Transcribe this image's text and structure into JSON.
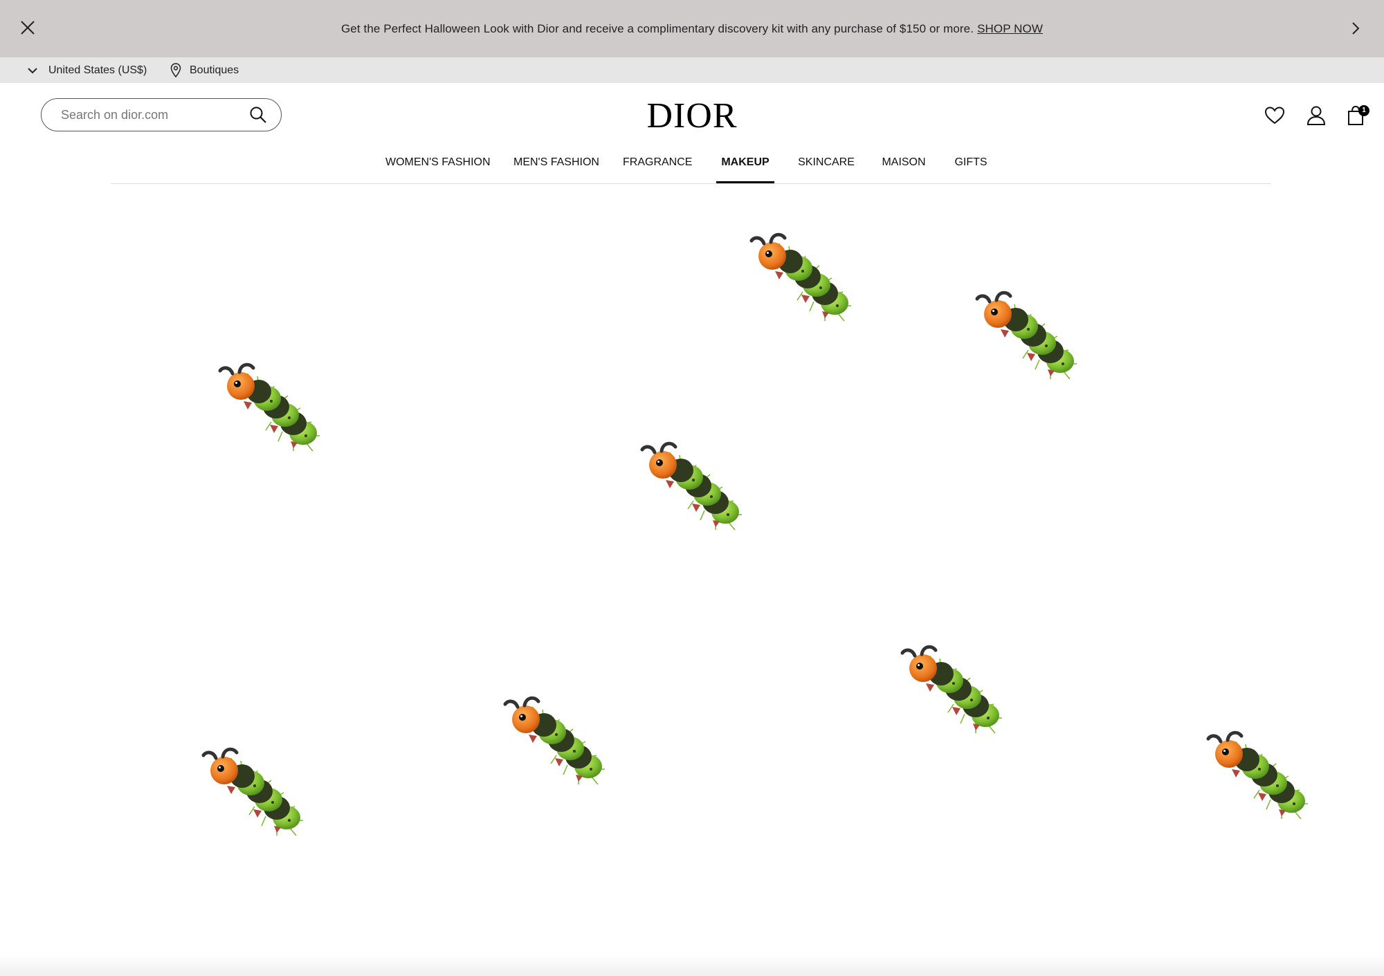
{
  "promo": {
    "text": "Get the Perfect Halloween Look with Dior and receive a complimentary discovery kit with any purchase of $150 or more.",
    "link": "SHOP NOW",
    "background": "#d0cbcb"
  },
  "utility": {
    "country": "United States (US$)",
    "boutiques": "Boutiques"
  },
  "header": {
    "search_placeholder": "Search on dior.com",
    "logo": "DIOR",
    "bag_count": "1"
  },
  "nav": {
    "items": [
      {
        "label": "WOMEN'S FASHION",
        "active": false
      },
      {
        "label": "MEN'S FASHION",
        "active": false
      },
      {
        "label": "FRAGRANCE",
        "active": false
      },
      {
        "label": "MAKEUP",
        "active": true
      },
      {
        "label": "SKINCARE",
        "active": false
      },
      {
        "label": "MAISON",
        "active": false
      },
      {
        "label": "GIFTS",
        "active": false
      }
    ]
  },
  "icons": {
    "close": "close-icon",
    "next": "chevron-right-icon",
    "country": "chevron-down-icon",
    "boutiques": "location-pin-icon",
    "search": "search-icon",
    "wishlist": "heart-icon",
    "account": "user-icon",
    "bag": "shopping-bag-icon",
    "decoration": "caterpillar-icon"
  },
  "colors": {
    "utility_bar": "#e6e6e6",
    "caterpillar_body": "#8cc63f",
    "caterpillar_head": "#e8731c"
  }
}
